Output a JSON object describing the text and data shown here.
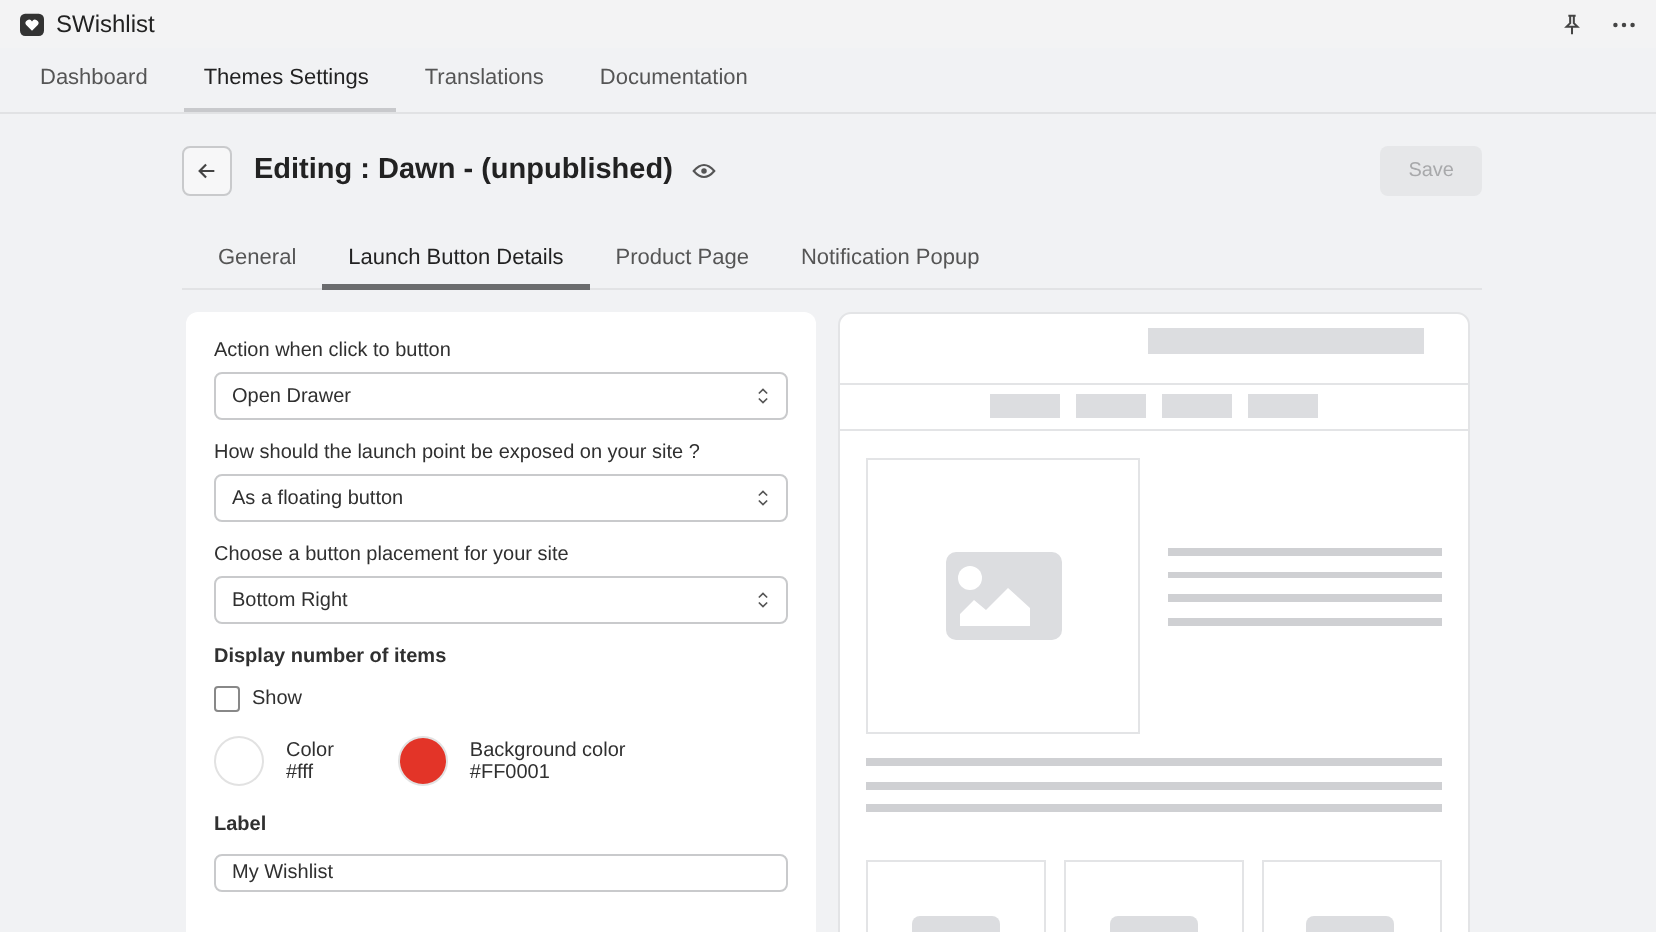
{
  "app": {
    "title": "SWishlist"
  },
  "nav": [
    {
      "label": "Dashboard",
      "selected": false
    },
    {
      "label": "Themes Settings",
      "selected": true
    },
    {
      "label": "Translations",
      "selected": false
    },
    {
      "label": "Documentation",
      "selected": false
    }
  ],
  "header": {
    "title": "Editing : Dawn - (unpublished)",
    "save": {
      "label": "Save",
      "disabled": true
    }
  },
  "tabs": [
    {
      "label": "General",
      "selected": false
    },
    {
      "label": "Launch Button Details",
      "selected": true
    },
    {
      "label": "Product Page",
      "selected": false
    },
    {
      "label": "Notification Popup",
      "selected": false
    }
  ],
  "form": {
    "selects": [
      {
        "label": "Action when click to button",
        "value": "Open Drawer"
      },
      {
        "label": "How should the launch point be exposed on your site ?",
        "value": "As a floating button"
      },
      {
        "label": "Choose a button placement for your site",
        "value": "Bottom Right"
      }
    ],
    "count_heading": "Display number of items",
    "show": {
      "label": "Show",
      "checked": false
    },
    "colors": [
      {
        "label": "Color",
        "value": "#fff",
        "color": "#ffffff"
      },
      {
        "label": "Background color",
        "value": "#FF0001",
        "color": "#e33428"
      }
    ],
    "label_field": {
      "label": "Label",
      "value": "My Wishlist"
    }
  }
}
